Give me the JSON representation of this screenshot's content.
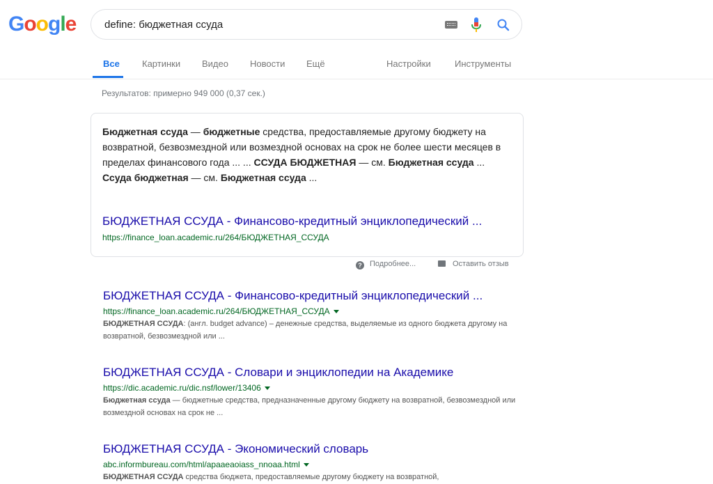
{
  "logo": [
    "G",
    "o",
    "o",
    "g",
    "l",
    "e"
  ],
  "logo_colors": [
    "#4285f4",
    "#ea4335",
    "#fbbc05",
    "#4285f4",
    "#34a853",
    "#ea4335"
  ],
  "search": {
    "query": "define: бюджетная ссуда"
  },
  "icons": {
    "keyboard": "keyboard-icon",
    "mic": "microphone-icon",
    "search": "search-icon"
  },
  "tabs": {
    "all": "Все",
    "images": "Картинки",
    "video": "Видео",
    "news": "Новости",
    "more": "Ещё",
    "settings": "Настройки",
    "tools": "Инструменты"
  },
  "stats": "Результатов: примерно 949 000 (0,37 сек.)",
  "featured": {
    "definition_parts": [
      {
        "t": "Бюджетная ссуда",
        "b": true
      },
      {
        "t": " — ",
        "b": false
      },
      {
        "t": "бюджетные",
        "b": true
      },
      {
        "t": " средства, предоставляемые другому бюджету на возвратной, безвозмездной или возмездной основах на срок не более шести месяцев в пределах финансового года ... ... ",
        "b": false
      },
      {
        "t": "ССУДА БЮДЖЕТНАЯ",
        "b": true
      },
      {
        "t": " — см. ",
        "b": false
      },
      {
        "t": "Бюджетная ссуда",
        "b": true
      },
      {
        "t": " ... ",
        "b": false
      },
      {
        "t": "Ссуда бюджетная",
        "b": true
      },
      {
        "t": " — см. ",
        "b": false
      },
      {
        "t": "Бюджетная ссуда",
        "b": true
      },
      {
        "t": " ...",
        "b": false
      }
    ],
    "title": "БЮДЖЕТНАЯ ССУДА - Финансово-кредитный энциклопедический ...",
    "url": "https://finance_loan.academic.ru/264/БЮДЖЕТНАЯ_ССУДА"
  },
  "feedback": {
    "about": "Подробнее...",
    "report": "Оставить отзыв"
  },
  "results": [
    {
      "title": "БЮДЖЕТНАЯ ССУДА - Финансово-кредитный энциклопедический ...",
      "url": "https://finance_loan.academic.ru/264/БЮДЖЕТНАЯ_ССУДА",
      "snippet": [
        {
          "t": "БЮДЖЕТНАЯ ССУДА",
          "b": true
        },
        {
          "t": ": (англ. budget advance) – денежные средства, выделяемые из одного бюджета другому на возвратной, безвозмездной или ...",
          "b": false
        }
      ]
    },
    {
      "title": "БЮДЖЕТНАЯ ССУДА - Словари и энциклопедии на Академике",
      "url": "https://dic.academic.ru/dic.nsf/lower/13406",
      "snippet": [
        {
          "t": "Бюджетная ссуда",
          "b": true
        },
        {
          "t": " — бюджетные средства, предназначенные другому бюджету на возвратной, безвозмездной или возмездной основах на срок не ...",
          "b": false
        }
      ]
    },
    {
      "title": "БЮДЖЕТНАЯ ССУДА - Экономический словарь",
      "url": "abc.informbureau.com/html/apaaeaoiass_nnoaa.html",
      "snippet": [
        {
          "t": "БЮДЖЕТНАЯ ССУДА",
          "b": true
        },
        {
          "t": " средства бюджета, предоставляемые другому бюджету на возвратной,",
          "b": false
        }
      ]
    }
  ]
}
